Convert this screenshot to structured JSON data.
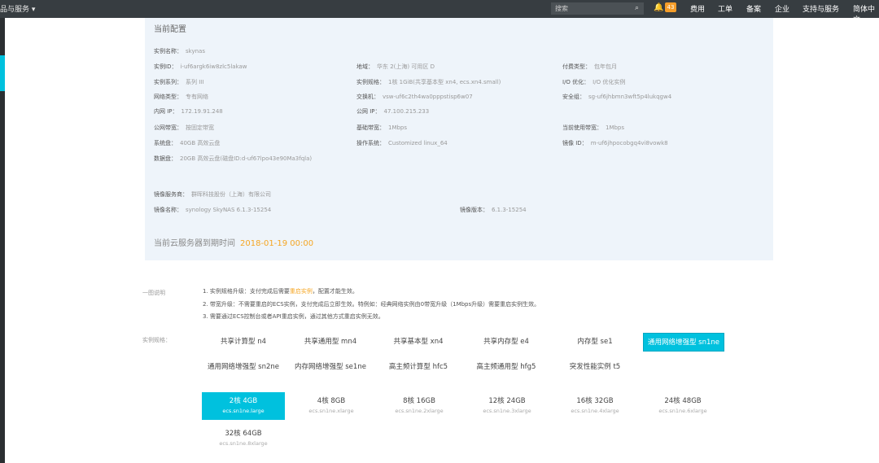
{
  "topbar": {
    "product_menu": "品与服务",
    "search_placeholder": "搜索",
    "badge_count": "43",
    "nav": [
      "费用",
      "工单",
      "备案",
      "企业",
      "支持与服务",
      "简体中文"
    ]
  },
  "config": {
    "title": "当前配置",
    "fields": [
      {
        "k": "实例名称：",
        "v": "skynas"
      },
      {
        "k": "实例ID：",
        "v": "i-uf6argk6iw8zlc5lakaw"
      },
      {
        "k": "地域：",
        "v": "华东 2(上海) 可用区 D"
      },
      {
        "k": "付费类型：",
        "v": "包年包月"
      },
      {
        "k": "实例系列：",
        "v": "系列 III"
      },
      {
        "k": "实例规格：",
        "v": "1核 1GiB(共享基本型 xn4, ecs.xn4.small)"
      },
      {
        "k": "I/O 优化：",
        "v": "I/O 优化实例"
      },
      {
        "k": "网络类型：",
        "v": "专有网络"
      },
      {
        "k": "交换机：",
        "v": "vsw-uf6c2th4wa0pppstisp6w07"
      },
      {
        "k": "安全组：",
        "v": "sg-uf6jhbmn3wft5p4lukqgw4"
      },
      {
        "k": "内网 IP：",
        "v": "172.19.91.248"
      },
      {
        "k": "公网 IP：",
        "v": "47.100.215.233"
      },
      {
        "k": "公网带宽：",
        "v": "按固定带宽"
      },
      {
        "k": "基础带宽：",
        "v": "1Mbps"
      },
      {
        "k": "当前使用带宽：",
        "v": "1Mbps"
      },
      {
        "k": "系统盘：",
        "v": "40GB 高效云盘"
      },
      {
        "k": "操作系统：",
        "v": "Customized linux_64"
      },
      {
        "k": "镜像 ID：",
        "v": "m-uf6jhpocobgq4vi8vowk8"
      },
      {
        "k": "数据盘：",
        "v": "20GB 高效云盘(磁盘ID:d-uf67lpo43e90Ma3fqla)"
      },
      {
        "k": "镜像服务商：",
        "v": "群晖科技股份（上海）有限公司"
      },
      {
        "k": "镜像名称：",
        "v": "synology SkyNAS 6.1.3-15254"
      },
      {
        "k": "镜像版本：",
        "v": "6.1.3-15254"
      }
    ],
    "expire_label": "当前云服务器到期时间",
    "expire_date": "2018-01-19 00:00"
  },
  "notes": {
    "label": "一图说明",
    "items": [
      {
        "pre": "1. 实例规格升级：支付完成后需要",
        "hl": "重启实例",
        "post": "，配置才能生效。"
      },
      {
        "pre": "2. 带宽升级：不需要重启的ECS实例，支付完成后立即生效。特例如：经典网络实例由0带宽升级（1Mbps升级）需要重启实例生效。",
        "hl": "",
        "post": ""
      },
      {
        "pre": "3. 需要通过ECS控制台或者API重启实例，通过其他方式重启实例无效。",
        "hl": "",
        "post": ""
      }
    ]
  },
  "types": {
    "label": "实例规格：",
    "row1": [
      "共享计算型 n4",
      "共享通用型 mn4",
      "共享基本型 xn4",
      "共享内存型 e4",
      "内存型 se1",
      "通用网络增强型 sn1ne"
    ],
    "row2": [
      "通用网络增强型 sn2ne",
      "内存网络增强型 se1ne",
      "高主频计算型 hfc5",
      "高主频通用型 hfg5",
      "突发性能实例 t5"
    ]
  },
  "specs": [
    {
      "a": "2核 4GB",
      "b": "ecs.sn1ne.large"
    },
    {
      "a": "4核 8GB",
      "b": "ecs.sn1ne.xlarge"
    },
    {
      "a": "8核 16GB",
      "b": "ecs.sn1ne.2xlarge"
    },
    {
      "a": "12核 24GB",
      "b": "ecs.sn1ne.3xlarge"
    },
    {
      "a": "16核 32GB",
      "b": "ecs.sn1ne.4xlarge"
    },
    {
      "a": "24核 48GB",
      "b": "ecs.sn1ne.6xlarge"
    },
    {
      "a": "32核 64GB",
      "b": "ecs.sn1ne.8xlarge"
    }
  ]
}
